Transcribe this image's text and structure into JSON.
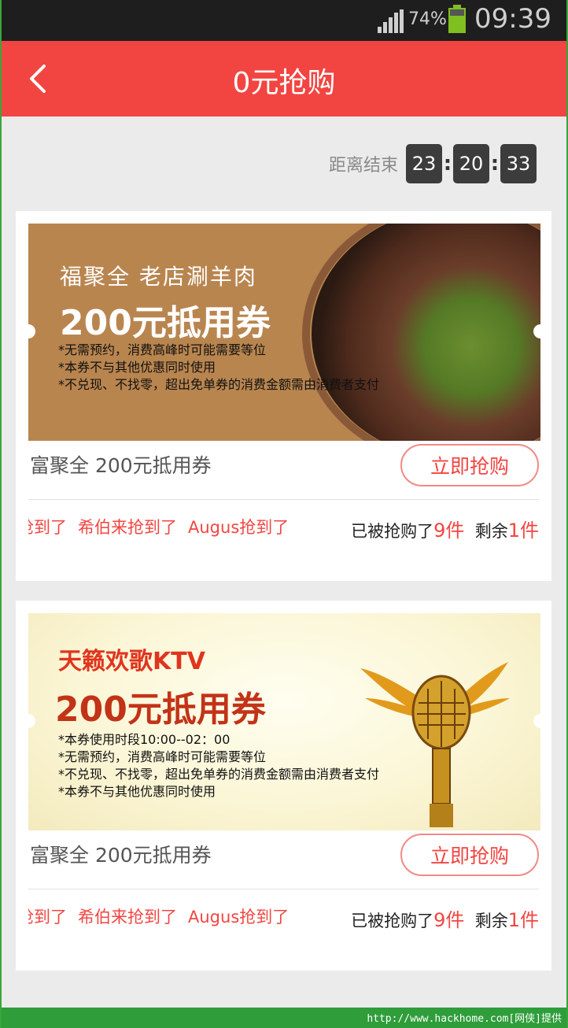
{
  "status_bar": {
    "battery": "74%",
    "time": "09:39"
  },
  "header": {
    "title": "0元抢购"
  },
  "countdown": {
    "label": "距离结束",
    "hours": "23",
    "minutes": "20",
    "seconds": "33",
    "separator": ":"
  },
  "cards": [
    {
      "banner_brand": "福聚全 老店涮羊肉",
      "banner_title": "200元抵用券",
      "banner_notes": [
        "*无需预约，消费高峰时可能需要等位",
        "*本券不与其他优惠同时使用",
        "*不兑现、不找零，超出免单券的消费金额需由消费者支付"
      ],
      "name": "富聚全 200元抵用券",
      "button": "立即抢购",
      "ticker": [
        "抢到了",
        "希伯来抢到了",
        "Augus抢到了"
      ],
      "sold_prefix": "已被抢购了",
      "sold_count": "9件",
      "remain_prefix": "剩余",
      "remain_count": "1件"
    },
    {
      "banner_brand": "天籁欢歌KTV",
      "banner_title": "200元抵用券",
      "banner_notes": [
        "*本券使用时段10:00--02：00",
        "*无需预约，消费高峰时可能需要等位",
        "*不兑现、不找零，超出免单券的消费金额需由消费者支付",
        "*本券不与其他优惠同时使用"
      ],
      "name": "富聚全 200元抵用券",
      "button": "立即抢购",
      "ticker": [
        "抢到了",
        "希伯来抢到了",
        "Augus抢到了"
      ],
      "sold_prefix": "已被抢购了",
      "sold_count": "9件",
      "remain_prefix": "剩余",
      "remain_count": "1件"
    }
  ],
  "footer": {
    "watermark": "http://www.hackhome.com[网侠]提供"
  },
  "colors": {
    "accent": "#f24541",
    "status_bar": "#1e1e1e",
    "background": "#ebebeb",
    "watermark_bar": "#2e9d3a"
  }
}
